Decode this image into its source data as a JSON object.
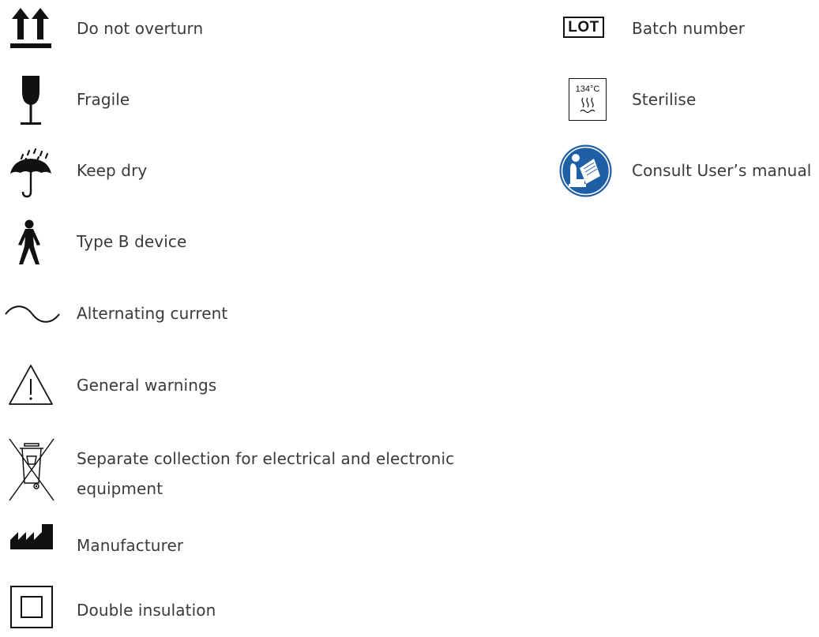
{
  "symbols": {
    "left": [
      {
        "icon": "this-way-up-arrows-icon",
        "label": "Do not overturn"
      },
      {
        "icon": "fragile-glass-icon",
        "label": "Fragile"
      },
      {
        "icon": "umbrella-rain-icon",
        "label": "Keep dry"
      },
      {
        "icon": "type-b-body-icon",
        "label": "Type B device"
      },
      {
        "icon": "sine-wave-icon",
        "label": "Alternating current"
      },
      {
        "icon": "warning-triangle-icon",
        "label": "General warnings"
      },
      {
        "icon": "crossed-bin-icon",
        "label_line1": "Separate collection for electrical and electronic",
        "label_line2": "equipment"
      },
      {
        "icon": "factory-icon",
        "label": "Manufacturer"
      },
      {
        "icon": "double-square-icon",
        "label": "Double insulation"
      }
    ],
    "right": [
      {
        "icon": "lot-box-icon",
        "icon_text": "LOT",
        "label": "Batch number"
      },
      {
        "icon": "sterilise-icon",
        "icon_text": "134°C",
        "label": "Sterilise"
      },
      {
        "icon": "manual-reader-icon",
        "label": "Consult User’s manual"
      }
    ]
  },
  "colors": {
    "text": "#3a3a3a",
    "icon": "#111111",
    "manual_blue": "#1f5fa6"
  }
}
